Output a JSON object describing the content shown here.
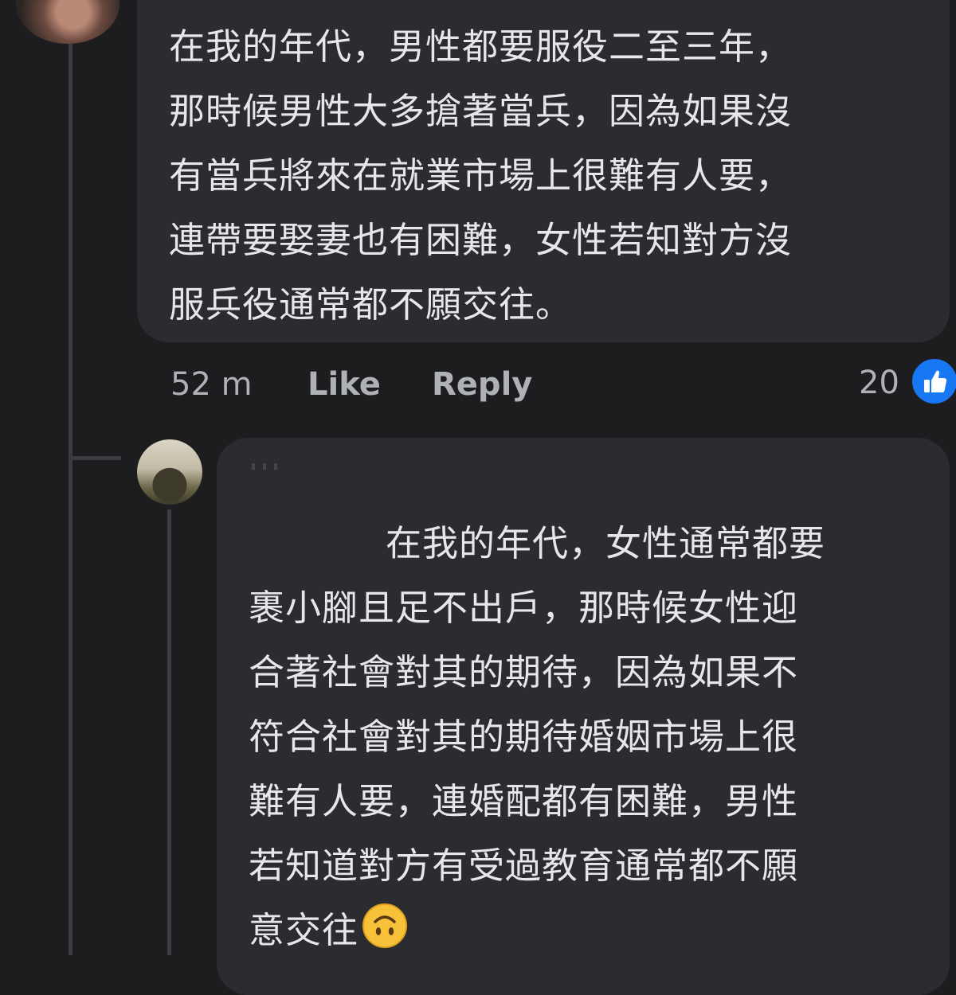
{
  "comment": {
    "lines": [
      "在我的年代，男性都要服役二至三年，",
      "那時候男性大多搶著當兵，因為如果沒",
      "有當兵將來在就業市場上很難有人要，",
      "連帶要娶妻也有困難，女性若知對方沒",
      "服兵役通常都不願交往。"
    ],
    "time": "52 m",
    "like_label": "Like",
    "reply_label": "Reply",
    "reaction_count": "20",
    "reaction_icon": "like-icon"
  },
  "reply": {
    "lines": [
      "在我的年代，女性通常都要",
      "裹小腳且足不出戶，那時候女性迎",
      "合著社會對其的期待，因為如果不",
      "符合社會對其的期待婚姻市場上很",
      "難有人要，連婚配都有困難，男性",
      "若知道對方有受過教育通常都不願",
      "意交往"
    ],
    "emoji": "upside-down-face-emoji"
  },
  "colors": {
    "background": "#1d1d1f",
    "bubble": "#2b2c30",
    "text": "#e6e7ea",
    "meta": "#aeb1b6",
    "like_blue": "#1877f2"
  }
}
